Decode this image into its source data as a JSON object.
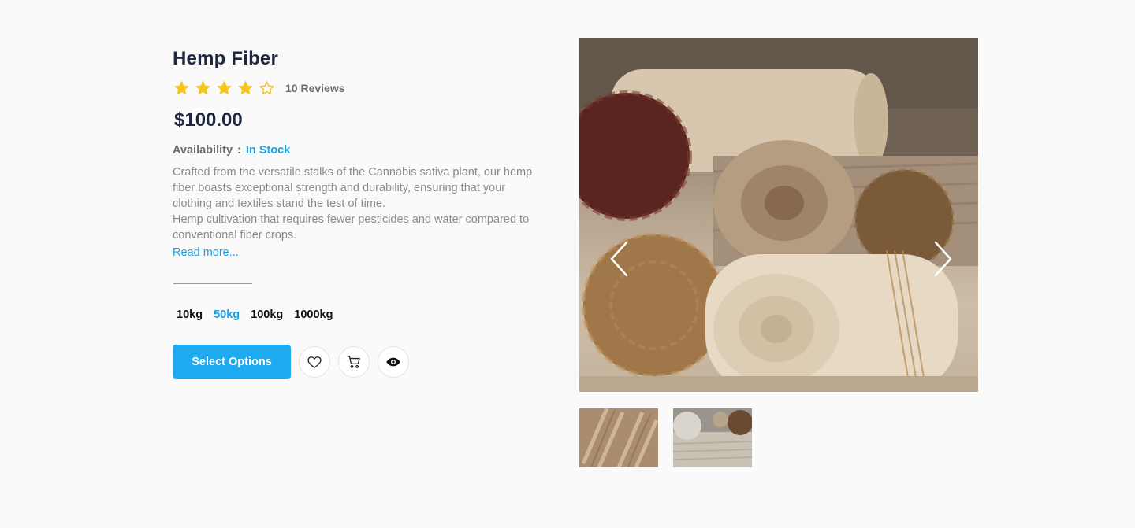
{
  "product": {
    "title": "Hemp Fiber",
    "rating": 4,
    "rating_max": 5,
    "reviews_label": "10 Reviews",
    "price": "$100.00",
    "availability_label": "Availability",
    "availability_sep": ":",
    "availability_value": "In Stock",
    "description_line1": "Crafted from the versatile stalks of the Cannabis sativa plant, our hemp fiber boasts exceptional strength and durability, ensuring that your clothing and textiles stand the test of time.",
    "description_line2": "Hemp cultivation that requires fewer pesticides and water compared to conventional fiber crops.",
    "read_more": "Read more..."
  },
  "weights": [
    {
      "label": "10kg",
      "active": false
    },
    {
      "label": "50kg",
      "active": true
    },
    {
      "label": "100kg",
      "active": false
    },
    {
      "label": "1000kg",
      "active": false
    }
  ],
  "actions": {
    "select_options": "Select Options",
    "wishlist_icon": "heart-icon",
    "cart_icon": "cart-icon",
    "quickview_icon": "eye-icon"
  },
  "gallery": {
    "prev_icon": "chevron-left-icon",
    "next_icon": "chevron-right-icon",
    "thumbnails": [
      "hemp-yarn-skeins",
      "hemp-fabric-rolls"
    ]
  },
  "colors": {
    "accent": "#1eaaf1",
    "link": "#1aa1e4",
    "star": "#f5c518",
    "heading": "#1f2840"
  }
}
